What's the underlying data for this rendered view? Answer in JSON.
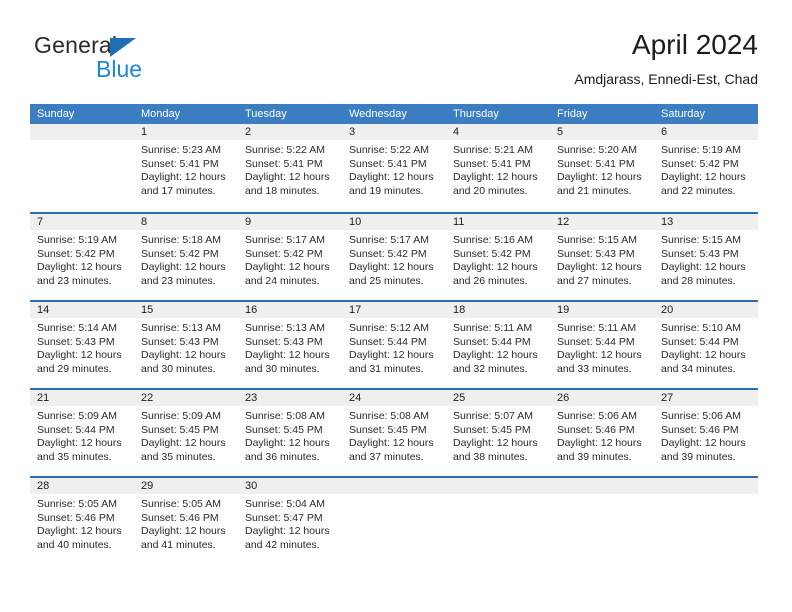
{
  "brand": {
    "line1": "General",
    "line2": "Blue",
    "triangle_color": "#1f6fb5",
    "blue_text_color": "#1f85d8"
  },
  "header": {
    "title": "April 2024",
    "subtitle": "Amdjarass, Ennedi-Est, Chad"
  },
  "theme": {
    "header_bar_color": "#3a7dc0",
    "row_separator_color": "#2a6cb0",
    "date_band_color": "#efefef",
    "text_color": "#2a2a2a"
  },
  "weekdays": [
    "Sunday",
    "Monday",
    "Tuesday",
    "Wednesday",
    "Thursday",
    "Friday",
    "Saturday"
  ],
  "weeks": [
    [
      {
        "day": "",
        "sunrise": "",
        "sunset": "",
        "daylight_line1": "",
        "daylight_line2": "",
        "empty": true
      },
      {
        "day": "1",
        "sunrise": "Sunrise: 5:23 AM",
        "sunset": "Sunset: 5:41 PM",
        "daylight_line1": "Daylight: 12 hours",
        "daylight_line2": "and 17 minutes."
      },
      {
        "day": "2",
        "sunrise": "Sunrise: 5:22 AM",
        "sunset": "Sunset: 5:41 PM",
        "daylight_line1": "Daylight: 12 hours",
        "daylight_line2": "and 18 minutes."
      },
      {
        "day": "3",
        "sunrise": "Sunrise: 5:22 AM",
        "sunset": "Sunset: 5:41 PM",
        "daylight_line1": "Daylight: 12 hours",
        "daylight_line2": "and 19 minutes."
      },
      {
        "day": "4",
        "sunrise": "Sunrise: 5:21 AM",
        "sunset": "Sunset: 5:41 PM",
        "daylight_line1": "Daylight: 12 hours",
        "daylight_line2": "and 20 minutes."
      },
      {
        "day": "5",
        "sunrise": "Sunrise: 5:20 AM",
        "sunset": "Sunset: 5:41 PM",
        "daylight_line1": "Daylight: 12 hours",
        "daylight_line2": "and 21 minutes."
      },
      {
        "day": "6",
        "sunrise": "Sunrise: 5:19 AM",
        "sunset": "Sunset: 5:42 PM",
        "daylight_line1": "Daylight: 12 hours",
        "daylight_line2": "and 22 minutes."
      }
    ],
    [
      {
        "day": "7",
        "sunrise": "Sunrise: 5:19 AM",
        "sunset": "Sunset: 5:42 PM",
        "daylight_line1": "Daylight: 12 hours",
        "daylight_line2": "and 23 minutes."
      },
      {
        "day": "8",
        "sunrise": "Sunrise: 5:18 AM",
        "sunset": "Sunset: 5:42 PM",
        "daylight_line1": "Daylight: 12 hours",
        "daylight_line2": "and 23 minutes."
      },
      {
        "day": "9",
        "sunrise": "Sunrise: 5:17 AM",
        "sunset": "Sunset: 5:42 PM",
        "daylight_line1": "Daylight: 12 hours",
        "daylight_line2": "and 24 minutes."
      },
      {
        "day": "10",
        "sunrise": "Sunrise: 5:17 AM",
        "sunset": "Sunset: 5:42 PM",
        "daylight_line1": "Daylight: 12 hours",
        "daylight_line2": "and 25 minutes."
      },
      {
        "day": "11",
        "sunrise": "Sunrise: 5:16 AM",
        "sunset": "Sunset: 5:42 PM",
        "daylight_line1": "Daylight: 12 hours",
        "daylight_line2": "and 26 minutes."
      },
      {
        "day": "12",
        "sunrise": "Sunrise: 5:15 AM",
        "sunset": "Sunset: 5:43 PM",
        "daylight_line1": "Daylight: 12 hours",
        "daylight_line2": "and 27 minutes."
      },
      {
        "day": "13",
        "sunrise": "Sunrise: 5:15 AM",
        "sunset": "Sunset: 5:43 PM",
        "daylight_line1": "Daylight: 12 hours",
        "daylight_line2": "and 28 minutes."
      }
    ],
    [
      {
        "day": "14",
        "sunrise": "Sunrise: 5:14 AM",
        "sunset": "Sunset: 5:43 PM",
        "daylight_line1": "Daylight: 12 hours",
        "daylight_line2": "and 29 minutes."
      },
      {
        "day": "15",
        "sunrise": "Sunrise: 5:13 AM",
        "sunset": "Sunset: 5:43 PM",
        "daylight_line1": "Daylight: 12 hours",
        "daylight_line2": "and 30 minutes."
      },
      {
        "day": "16",
        "sunrise": "Sunrise: 5:13 AM",
        "sunset": "Sunset: 5:43 PM",
        "daylight_line1": "Daylight: 12 hours",
        "daylight_line2": "and 30 minutes."
      },
      {
        "day": "17",
        "sunrise": "Sunrise: 5:12 AM",
        "sunset": "Sunset: 5:44 PM",
        "daylight_line1": "Daylight: 12 hours",
        "daylight_line2": "and 31 minutes."
      },
      {
        "day": "18",
        "sunrise": "Sunrise: 5:11 AM",
        "sunset": "Sunset: 5:44 PM",
        "daylight_line1": "Daylight: 12 hours",
        "daylight_line2": "and 32 minutes."
      },
      {
        "day": "19",
        "sunrise": "Sunrise: 5:11 AM",
        "sunset": "Sunset: 5:44 PM",
        "daylight_line1": "Daylight: 12 hours",
        "daylight_line2": "and 33 minutes."
      },
      {
        "day": "20",
        "sunrise": "Sunrise: 5:10 AM",
        "sunset": "Sunset: 5:44 PM",
        "daylight_line1": "Daylight: 12 hours",
        "daylight_line2": "and 34 minutes."
      }
    ],
    [
      {
        "day": "21",
        "sunrise": "Sunrise: 5:09 AM",
        "sunset": "Sunset: 5:44 PM",
        "daylight_line1": "Daylight: 12 hours",
        "daylight_line2": "and 35 minutes."
      },
      {
        "day": "22",
        "sunrise": "Sunrise: 5:09 AM",
        "sunset": "Sunset: 5:45 PM",
        "daylight_line1": "Daylight: 12 hours",
        "daylight_line2": "and 35 minutes."
      },
      {
        "day": "23",
        "sunrise": "Sunrise: 5:08 AM",
        "sunset": "Sunset: 5:45 PM",
        "daylight_line1": "Daylight: 12 hours",
        "daylight_line2": "and 36 minutes."
      },
      {
        "day": "24",
        "sunrise": "Sunrise: 5:08 AM",
        "sunset": "Sunset: 5:45 PM",
        "daylight_line1": "Daylight: 12 hours",
        "daylight_line2": "and 37 minutes."
      },
      {
        "day": "25",
        "sunrise": "Sunrise: 5:07 AM",
        "sunset": "Sunset: 5:45 PM",
        "daylight_line1": "Daylight: 12 hours",
        "daylight_line2": "and 38 minutes."
      },
      {
        "day": "26",
        "sunrise": "Sunrise: 5:06 AM",
        "sunset": "Sunset: 5:46 PM",
        "daylight_line1": "Daylight: 12 hours",
        "daylight_line2": "and 39 minutes."
      },
      {
        "day": "27",
        "sunrise": "Sunrise: 5:06 AM",
        "sunset": "Sunset: 5:46 PM",
        "daylight_line1": "Daylight: 12 hours",
        "daylight_line2": "and 39 minutes."
      }
    ],
    [
      {
        "day": "28",
        "sunrise": "Sunrise: 5:05 AM",
        "sunset": "Sunset: 5:46 PM",
        "daylight_line1": "Daylight: 12 hours",
        "daylight_line2": "and 40 minutes."
      },
      {
        "day": "29",
        "sunrise": "Sunrise: 5:05 AM",
        "sunset": "Sunset: 5:46 PM",
        "daylight_line1": "Daylight: 12 hours",
        "daylight_line2": "and 41 minutes."
      },
      {
        "day": "30",
        "sunrise": "Sunrise: 5:04 AM",
        "sunset": "Sunset: 5:47 PM",
        "daylight_line1": "Daylight: 12 hours",
        "daylight_line2": "and 42 minutes."
      },
      {
        "day": "",
        "sunrise": "",
        "sunset": "",
        "daylight_line1": "",
        "daylight_line2": "",
        "empty": true
      },
      {
        "day": "",
        "sunrise": "",
        "sunset": "",
        "daylight_line1": "",
        "daylight_line2": "",
        "empty": true
      },
      {
        "day": "",
        "sunrise": "",
        "sunset": "",
        "daylight_line1": "",
        "daylight_line2": "",
        "empty": true
      },
      {
        "day": "",
        "sunrise": "",
        "sunset": "",
        "daylight_line1": "",
        "daylight_line2": "",
        "empty": true
      }
    ]
  ]
}
